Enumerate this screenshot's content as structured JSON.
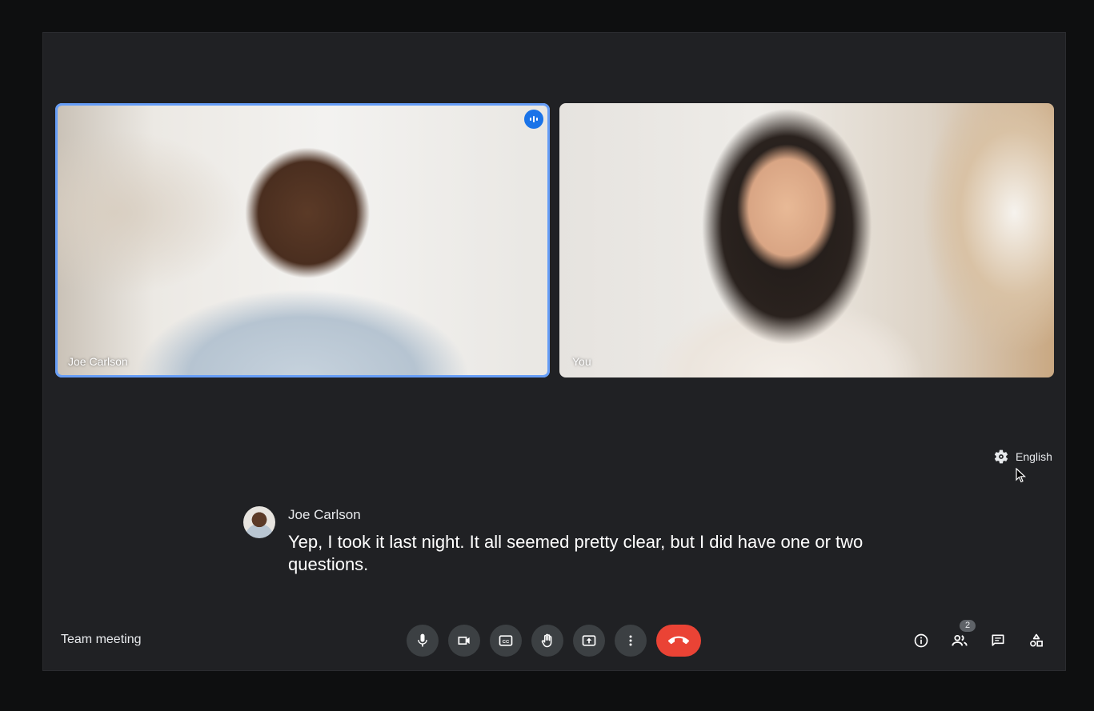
{
  "participants": [
    {
      "name": "Joe Carlson",
      "speaking": true
    },
    {
      "name": "You",
      "speaking": false
    }
  ],
  "captions": {
    "language": "English",
    "speaker": "Joe Carlson",
    "text": "Yep, I took it last night. It all seemed pretty clear, but I did have one or two questions."
  },
  "bottom_bar": {
    "meeting_title": "Team meeting",
    "controls": [
      "mic-icon",
      "camera-icon",
      "captions-icon",
      "raise-hand-icon",
      "present-icon",
      "more-icon",
      "end-call-icon"
    ],
    "right_controls": [
      "info-icon",
      "people-icon",
      "chat-icon",
      "activities-icon"
    ],
    "participant_count": "2"
  },
  "colors": {
    "background": "#202124",
    "button": "#3c4043",
    "end_call": "#ea4335",
    "speaking_border": "#669df6",
    "speaking_badge": "#1a73e8"
  }
}
